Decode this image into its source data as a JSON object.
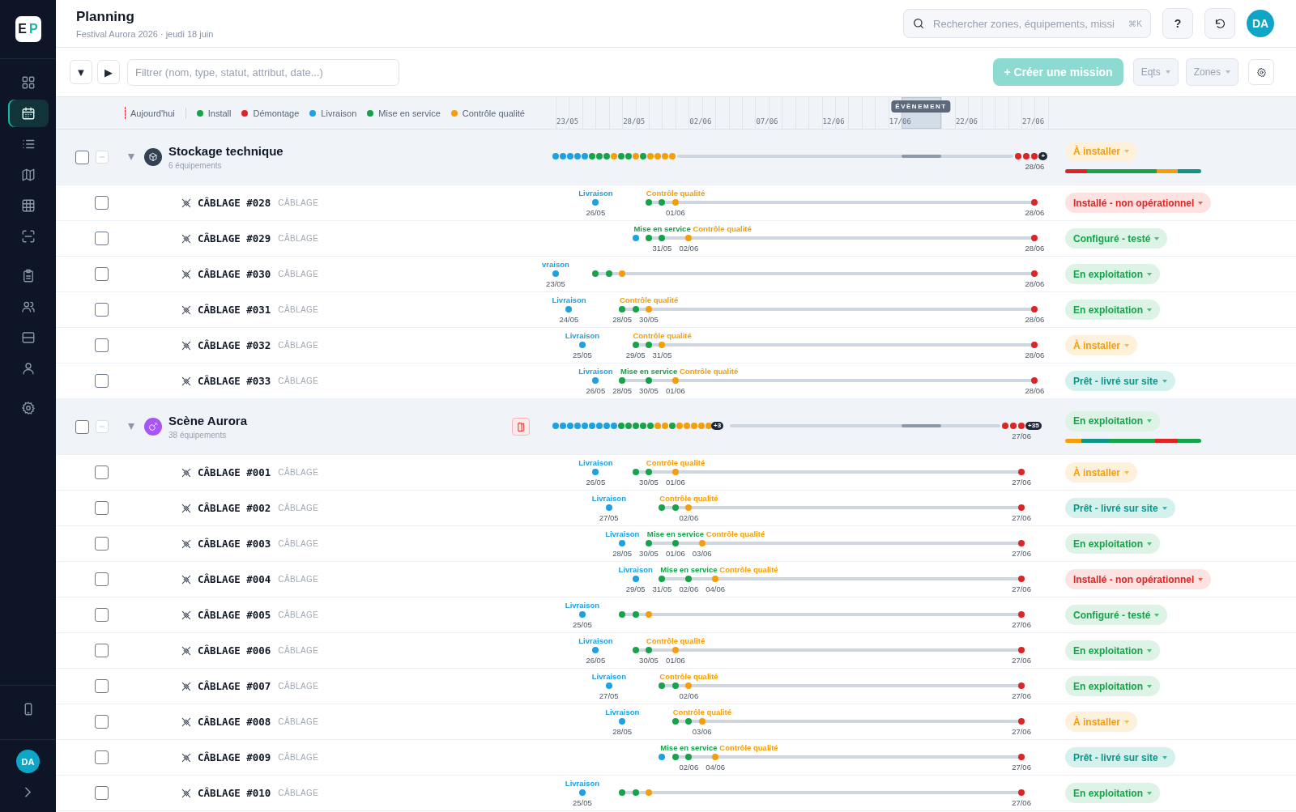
{
  "sidebar": {
    "logo": [
      "E",
      "P"
    ],
    "nav_groups": [
      {
        "items": [
          {
            "kind": "grid",
            "selected": false
          },
          {
            "kind": "calendar",
            "selected": true
          },
          {
            "kind": "list",
            "selected": false
          },
          {
            "kind": "map",
            "selected": false
          },
          {
            "kind": "table",
            "selected": false
          },
          {
            "kind": "scan",
            "selected": false
          }
        ]
      },
      {
        "items": [
          {
            "kind": "clipboard",
            "selected": false
          },
          {
            "kind": "users",
            "selected": false
          },
          {
            "kind": "storage",
            "selected": false
          },
          {
            "kind": "team",
            "selected": false
          }
        ]
      },
      {
        "items": [
          {
            "kind": "settings",
            "selected": false
          }
        ]
      }
    ],
    "user": "DA"
  },
  "header": {
    "title": "Planning",
    "subtitle": "Festival Aurora 2026 · jeudi 18 juin",
    "search": {
      "placeholder": "Rechercher zones, équipements, missi",
      "shortcut": "⌘K"
    },
    "help": "?",
    "user": "DA"
  },
  "toolbar": {
    "expand_all": "▼",
    "collapse_all": "▶",
    "filter": {
      "placeholder": "Filtrer (nom, type, statut, attribut, date...)"
    },
    "create": "+ Créer une mission",
    "dropdowns": [
      "Eqts",
      "Zones"
    ]
  },
  "legend": {
    "today": "Aujourd'hui",
    "items": [
      {
        "kind": "install",
        "label": "Install"
      },
      {
        "kind": "demontage",
        "label": "Démontage"
      },
      {
        "kind": "livraison",
        "label": "Livraison"
      },
      {
        "kind": "mise",
        "label": "Mise en service"
      },
      {
        "kind": "controle",
        "label": "Contrôle qualité"
      }
    ]
  },
  "timeline": {
    "ticks": [
      "23/05",
      "28/05",
      "02/06",
      "07/06",
      "12/06",
      "17/06",
      "22/06",
      "27/06"
    ],
    "event": "ÉVÈNEMENT"
  },
  "groups": [
    {
      "name": "Stockage technique",
      "count": "6 équipements",
      "kind": "storage",
      "color": "#334155",
      "checked": false,
      "expanded": true,
      "alert": false,
      "lead": [
        {
          "kind": "livraison"
        },
        {
          "kind": "livraison"
        },
        {
          "kind": "livraison"
        },
        {
          "kind": "livraison"
        },
        {
          "kind": "livraison"
        },
        {
          "kind": "install"
        },
        {
          "kind": "install"
        },
        {
          "kind": "install"
        },
        {
          "kind": "controle"
        },
        {
          "kind": "install"
        },
        {
          "kind": "install"
        },
        {
          "kind": "controle"
        },
        {
          "kind": "install"
        },
        {
          "kind": "controle"
        },
        {
          "kind": "controle"
        },
        {
          "kind": "controle"
        },
        {
          "kind": "controle"
        }
      ],
      "tail": [
        {
          "kind": "demontage"
        },
        {
          "kind": "demontage"
        },
        {
          "kind": "demontage"
        }
      ],
      "tail_more": "+",
      "end_date": "28/06",
      "status": {
        "label": "À installer",
        "kind": "todo"
      },
      "progress": [
        {
          "color": "#dc2626"
        },
        {
          "color": "#16a34a"
        },
        {
          "color": "#f59e0b"
        },
        {
          "color": "#0f9488"
        }
      ],
      "items": [
        {
          "name": "CÂBLAGE #028",
          "type": "CÂBLAGE",
          "checked": false,
          "status": {
            "label": "Installé - non opérationnel",
            "kind": "alert"
          },
          "markers": [
            {
              "kind": "livraison",
              "label": "Livraison",
              "date": "26/05"
            },
            {
              "kind": "install"
            },
            {
              "kind": "install"
            },
            {
              "kind": "controle",
              "label": "Contrôle qualité",
              "date": "01/06"
            },
            {
              "kind": "demontage",
              "date": "28/06"
            }
          ]
        },
        {
          "name": "CÂBLAGE #029",
          "type": "CÂBLAGE",
          "checked": false,
          "status": {
            "label": "Configuré - testé",
            "kind": "ok"
          },
          "markers": [
            {
              "kind": "livraison"
            },
            {
              "kind": "install"
            },
            {
              "kind": "mise",
              "label": "Mise en service",
              "date": "31/05"
            },
            {
              "kind": "controle",
              "label": "Contrôle qualité",
              "date": "02/06"
            },
            {
              "kind": "demontage",
              "date": "28/06"
            }
          ]
        },
        {
          "name": "CÂBLAGE #030",
          "type": "CÂBLAGE",
          "checked": false,
          "status": {
            "label": "En exploitation",
            "kind": "ok"
          },
          "markers": [
            {
              "kind": "livraison",
              "label": "vraison",
              "date": "23/05"
            },
            {
              "kind": "install"
            },
            {
              "kind": "install"
            },
            {
              "kind": "controle"
            },
            {
              "kind": "demontage",
              "date": "28/06"
            }
          ]
        },
        {
          "name": "CÂBLAGE #031",
          "type": "CÂBLAGE",
          "checked": false,
          "status": {
            "label": "En exploitation",
            "kind": "ok"
          },
          "markers": [
            {
              "kind": "livraison",
              "label": "Livraison",
              "date": "24/05"
            },
            {
              "kind": "install",
              "date": "28/05"
            },
            {
              "kind": "install"
            },
            {
              "kind": "controle",
              "label": "Contrôle qualité",
              "date": "30/05"
            },
            {
              "kind": "demontage",
              "date": "28/06"
            }
          ]
        },
        {
          "name": "CÂBLAGE #032",
          "type": "CÂBLAGE",
          "checked": false,
          "status": {
            "label": "À installer",
            "kind": "todo"
          },
          "markers": [
            {
              "kind": "livraison",
              "label": "Livraison",
              "date": "25/05"
            },
            {
              "kind": "install",
              "date": "29/05"
            },
            {
              "kind": "install"
            },
            {
              "kind": "controle",
              "label": "Contrôle qualité",
              "date": "31/05"
            },
            {
              "kind": "demontage",
              "date": "28/06"
            }
          ]
        },
        {
          "name": "CÂBLAGE #033",
          "type": "CÂBLAGE",
          "checked": false,
          "status": {
            "label": "Prêt - livré sur site",
            "kind": "ready"
          },
          "markers": [
            {
              "kind": "livraison",
              "label": "Livraison",
              "date": "26/05"
            },
            {
              "kind": "install",
              "date": "28/05"
            },
            {
              "kind": "mise",
              "label": "Mise en service",
              "date": "30/05"
            },
            {
              "kind": "controle",
              "label": "Contrôle qualité",
              "date": "01/06"
            },
            {
              "kind": "demontage",
              "date": "28/06"
            }
          ]
        }
      ]
    },
    {
      "name": "Scène Aurora",
      "count": "38 équipements",
      "kind": "stage",
      "color": "#a855f7",
      "checked": false,
      "expanded": true,
      "alert": true,
      "lead": [
        {
          "kind": "livraison"
        },
        {
          "kind": "livraison"
        },
        {
          "kind": "livraison"
        },
        {
          "kind": "livraison"
        },
        {
          "kind": "livraison"
        },
        {
          "kind": "livraison"
        },
        {
          "kind": "livraison"
        },
        {
          "kind": "livraison"
        },
        {
          "kind": "livraison"
        },
        {
          "kind": "install"
        },
        {
          "kind": "install"
        },
        {
          "kind": "install"
        },
        {
          "kind": "install"
        },
        {
          "kind": "install"
        },
        {
          "kind": "controle"
        },
        {
          "kind": "controle"
        },
        {
          "kind": "install"
        },
        {
          "kind": "controle"
        },
        {
          "kind": "controle"
        },
        {
          "kind": "controle"
        },
        {
          "kind": "controle"
        },
        {
          "kind": "controle"
        }
      ],
      "lead_more": "+3",
      "tail": [
        {
          "kind": "demontage"
        },
        {
          "kind": "demontage"
        },
        {
          "kind": "demontage"
        }
      ],
      "tail_more": "+35",
      "end_date": "27/06",
      "status": {
        "label": "En exploitation",
        "kind": "ok"
      },
      "progress": [
        {
          "color": "#f59e0b"
        },
        {
          "color": "#0f9488"
        },
        {
          "color": "#16a34a"
        },
        {
          "color": "#dc2626"
        },
        {
          "color": "#16a34a"
        }
      ],
      "items": [
        {
          "name": "CÂBLAGE #001",
          "type": "CÂBLAGE",
          "checked": false,
          "status": {
            "label": "À installer",
            "kind": "todo"
          },
          "markers": [
            {
              "kind": "livraison",
              "label": "Livraison",
              "date": "26/05"
            },
            {
              "kind": "install"
            },
            {
              "kind": "install",
              "date": "30/05"
            },
            {
              "kind": "controle",
              "label": "Contrôle qualité",
              "date": "01/06"
            },
            {
              "kind": "demontage",
              "date": "27/06"
            }
          ]
        },
        {
          "name": "CÂBLAGE #002",
          "type": "CÂBLAGE",
          "checked": false,
          "status": {
            "label": "Prêt - livré sur site",
            "kind": "ready"
          },
          "markers": [
            {
              "kind": "livraison",
              "label": "Livraison",
              "date": "27/05"
            },
            {
              "kind": "install"
            },
            {
              "kind": "install"
            },
            {
              "kind": "controle",
              "label": "Contrôle qualité",
              "date": "02/06"
            },
            {
              "kind": "demontage",
              "date": "27/06"
            }
          ]
        },
        {
          "name": "CÂBLAGE #003",
          "type": "CÂBLAGE",
          "checked": false,
          "status": {
            "label": "En exploitation",
            "kind": "ok"
          },
          "markers": [
            {
              "kind": "livraison",
              "label": "Livraison",
              "date": "28/05"
            },
            {
              "kind": "install",
              "date": "30/05"
            },
            {
              "kind": "mise",
              "label": "Mise en service",
              "date": "01/06"
            },
            {
              "kind": "controle",
              "label": "Contrôle qualité",
              "date": "03/06"
            },
            {
              "kind": "demontage",
              "date": "27/06"
            }
          ]
        },
        {
          "name": "CÂBLAGE #004",
          "type": "CÂBLAGE",
          "checked": false,
          "status": {
            "label": "Installé - non opérationnel",
            "kind": "alert"
          },
          "markers": [
            {
              "kind": "livraison",
              "label": "Livraison",
              "date": "29/05"
            },
            {
              "kind": "install",
              "date": "31/05"
            },
            {
              "kind": "mise",
              "label": "Mise en service",
              "date": "02/06"
            },
            {
              "kind": "controle",
              "label": "Contrôle qualité",
              "date": "04/06"
            },
            {
              "kind": "demontage",
              "date": "27/06"
            }
          ]
        },
        {
          "name": "CÂBLAGE #005",
          "type": "CÂBLAGE",
          "checked": false,
          "status": {
            "label": "Configuré - testé",
            "kind": "ok"
          },
          "markers": [
            {
              "kind": "livraison",
              "label": "Livraison",
              "date": "25/05"
            },
            {
              "kind": "install"
            },
            {
              "kind": "install"
            },
            {
              "kind": "controle"
            },
            {
              "kind": "demontage",
              "date": "27/06"
            }
          ]
        },
        {
          "name": "CÂBLAGE #006",
          "type": "CÂBLAGE",
          "checked": false,
          "status": {
            "label": "En exploitation",
            "kind": "ok"
          },
          "markers": [
            {
              "kind": "livraison",
              "label": "Livraison",
              "date": "26/05"
            },
            {
              "kind": "install"
            },
            {
              "kind": "install",
              "date": "30/05"
            },
            {
              "kind": "controle",
              "label": "Contrôle qualité",
              "date": "01/06"
            },
            {
              "kind": "demontage",
              "date": "27/06"
            }
          ]
        },
        {
          "name": "CÂBLAGE #007",
          "type": "CÂBLAGE",
          "checked": false,
          "status": {
            "label": "En exploitation",
            "kind": "ok"
          },
          "markers": [
            {
              "kind": "livraison",
              "label": "Livraison",
              "date": "27/05"
            },
            {
              "kind": "install"
            },
            {
              "kind": "install"
            },
            {
              "kind": "controle",
              "label": "Contrôle qualité",
              "date": "02/06"
            },
            {
              "kind": "demontage",
              "date": "27/06"
            }
          ]
        },
        {
          "name": "CÂBLAGE #008",
          "type": "CÂBLAGE",
          "checked": false,
          "status": {
            "label": "À installer",
            "kind": "todo"
          },
          "markers": [
            {
              "kind": "livraison",
              "label": "Livraison",
              "date": "28/05"
            },
            {
              "kind": "install"
            },
            {
              "kind": "install"
            },
            {
              "kind": "controle",
              "label": "Contrôle qualité",
              "date": "03/06"
            },
            {
              "kind": "demontage",
              "date": "27/06"
            }
          ]
        },
        {
          "name": "CÂBLAGE #009",
          "type": "CÂBLAGE",
          "checked": false,
          "status": {
            "label": "Prêt - livré sur site",
            "kind": "ready"
          },
          "markers": [
            {
              "kind": "livraison"
            },
            {
              "kind": "install"
            },
            {
              "kind": "mise",
              "label": "Mise en service",
              "date": "02/06"
            },
            {
              "kind": "controle",
              "label": "Contrôle qualité",
              "date": "04/06"
            },
            {
              "kind": "demontage",
              "date": "27/06"
            }
          ]
        },
        {
          "name": "CÂBLAGE #010",
          "type": "CÂBLAGE",
          "checked": false,
          "status": {
            "label": "En exploitation",
            "kind": "ok"
          },
          "markers": [
            {
              "kind": "livraison",
              "label": "Livraison",
              "date": "25/05"
            },
            {
              "kind": "install"
            },
            {
              "kind": "install"
            },
            {
              "kind": "controle"
            },
            {
              "kind": "demontage",
              "date": "27/06"
            }
          ]
        }
      ]
    }
  ]
}
